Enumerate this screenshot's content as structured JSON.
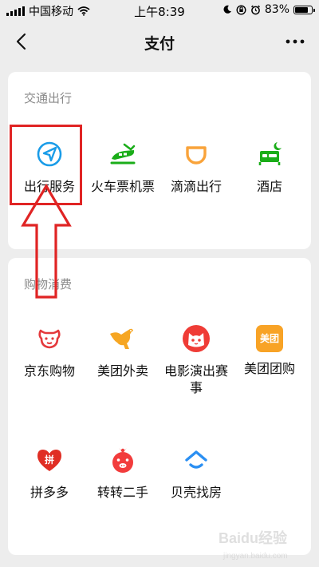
{
  "status_bar": {
    "carrier": "中国移动",
    "time": "上午8:39",
    "battery": "83%",
    "battery_level": 0.83
  },
  "nav": {
    "title": "支付",
    "back_icon": "chevron-left-icon",
    "more_icon": "more-dots-icon"
  },
  "sections": {
    "transport": {
      "title": "交通出行",
      "items": [
        {
          "label": "出行服务",
          "icon": "navigation-arrow-icon",
          "color": "#1a9ce8"
        },
        {
          "label": "火车票机票",
          "icon": "train-plane-icon",
          "color": "#1aad19"
        },
        {
          "label": "滴滴出行",
          "icon": "didi-icon",
          "color": "#f9a33a"
        },
        {
          "label": "酒店",
          "icon": "hotel-bed-icon",
          "color": "#1aad19"
        }
      ]
    },
    "shopping": {
      "title": "购物消费",
      "items": [
        {
          "label": "京东购物",
          "icon": "jd-dog-icon",
          "color": "#e4393c"
        },
        {
          "label": "美团外卖",
          "icon": "kangaroo-icon",
          "color": "#f6a623"
        },
        {
          "label": "电影演出赛事",
          "icon": "maoyan-cat-icon",
          "color": "#ef3c36"
        },
        {
          "label": "美团团购",
          "icon": "meituan-logo-icon",
          "color": "#f8a326",
          "logo_text": "美团"
        },
        {
          "label": "拼多多",
          "icon": "pinduoduo-heart-icon",
          "color": "#e02e24",
          "logo_text": "拼"
        },
        {
          "label": "转转二手",
          "icon": "zhuanzhuan-pig-icon",
          "color": "#f23c3c"
        },
        {
          "label": "贝壳找房",
          "icon": "beike-house-icon",
          "color": "#2b8ff2"
        }
      ]
    }
  },
  "watermark": {
    "text": "Baidu经验",
    "sub": "jingyan.baidu.com"
  },
  "colors": {
    "background": "#ededed",
    "card": "#ffffff",
    "highlight": "#e02424"
  }
}
